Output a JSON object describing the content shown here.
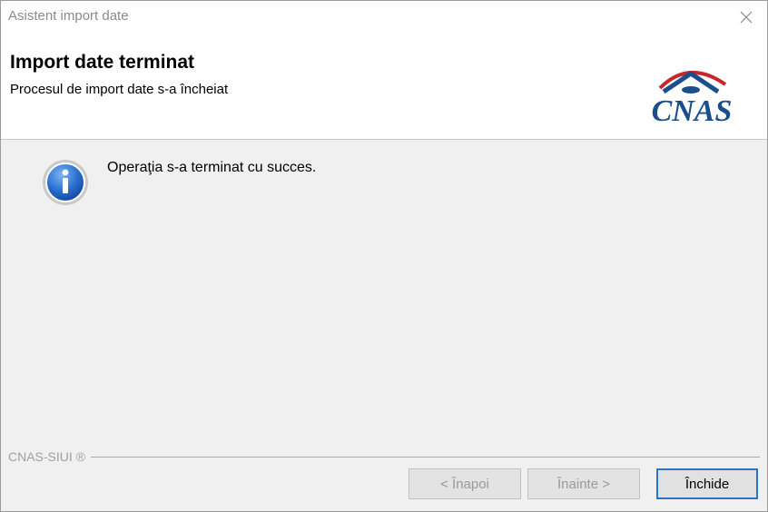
{
  "window": {
    "title": "Asistent import date",
    "close_icon": "close-icon"
  },
  "header": {
    "title": "Import date terminat",
    "subtitle": "Procesul de import date s-a încheiat",
    "logo_text": "CNAS",
    "brand_color": "#1a4e8c",
    "accent_color": "#c8262b"
  },
  "content": {
    "icon": "info-icon",
    "message": "Operaţia s-a terminat cu succes."
  },
  "footer": {
    "group_label": "CNAS-SIUI ®",
    "buttons": {
      "back": "< Înapoi",
      "next": "Înainte >",
      "close": "Închide"
    }
  }
}
